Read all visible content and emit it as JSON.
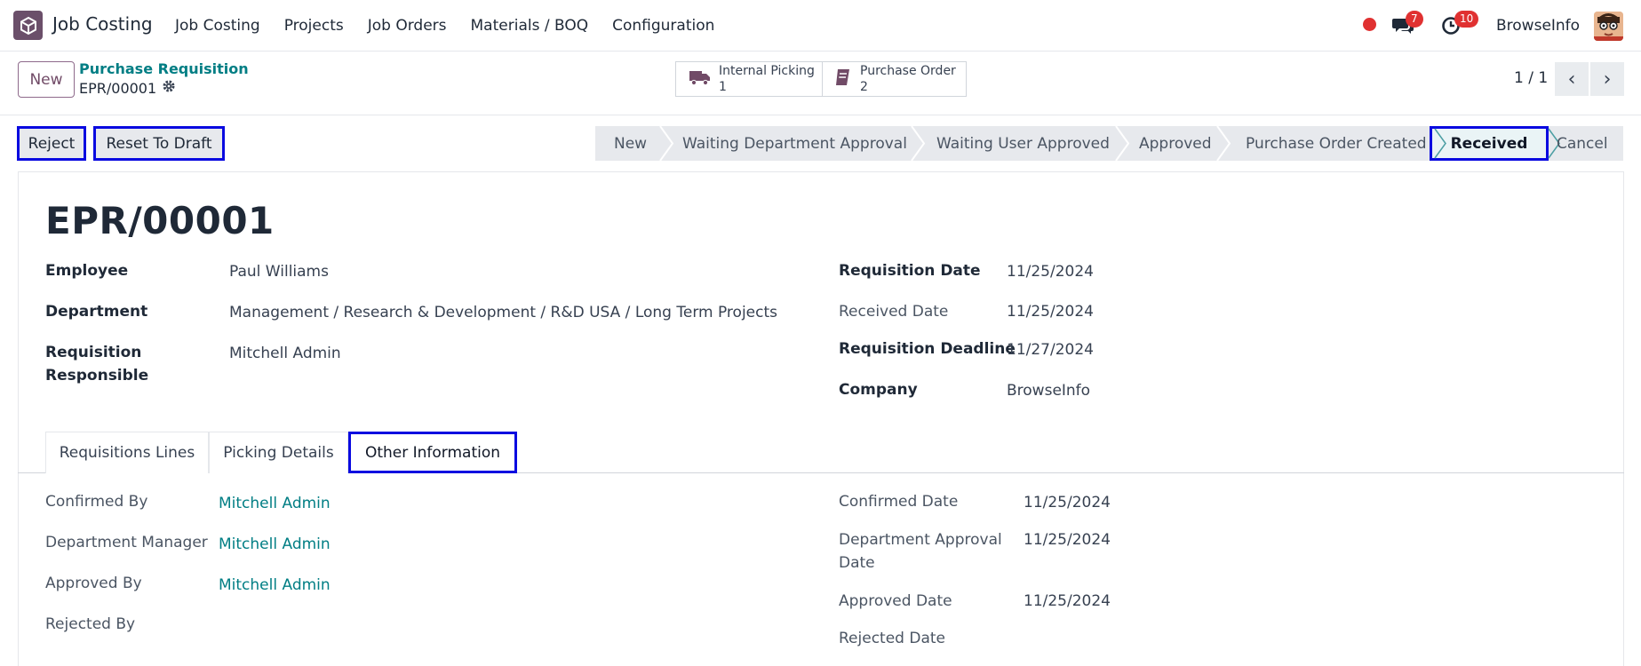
{
  "navbar": {
    "app_name": "Job Costing",
    "menu": [
      "Job Costing",
      "Projects",
      "Job Orders",
      "Materials / BOQ",
      "Configuration"
    ],
    "chat_count": "7",
    "activity_count": "10",
    "user_name": "BrowseInfo"
  },
  "control_panel": {
    "new_label": "New",
    "breadcrumb_parent": "Purchase Requisition",
    "breadcrumb_current": "EPR/00001",
    "smart_buttons": [
      {
        "label": "Internal Picking",
        "count": "1",
        "icon": "truck-icon"
      },
      {
        "label": "Purchase Order",
        "count": "2",
        "icon": "book-icon"
      }
    ],
    "pager": "1 / 1"
  },
  "actions": {
    "reject_label": "Reject",
    "reset_label": "Reset To Draft"
  },
  "status": {
    "stages": [
      "New",
      "Waiting Department Approval",
      "Waiting User Approved",
      "Approved",
      "Purchase Order Created",
      "Received",
      "Cancel"
    ],
    "active": "Received"
  },
  "form": {
    "title": "EPR/00001",
    "left": {
      "employee_label": "Employee",
      "employee_value": "Paul Williams",
      "department_label": "Department",
      "department_value": "Management / Research & Development / R&D USA / Long Term Projects",
      "responsible_label_1": "Requisition",
      "responsible_label_2": "Responsible",
      "responsible_value": "Mitchell Admin"
    },
    "right": {
      "req_date_label": "Requisition Date",
      "req_date_value": "11/25/2024",
      "received_date_label": "Received Date",
      "received_date_value": "11/25/2024",
      "deadline_label": "Requisition Deadline",
      "deadline_value": "11/27/2024",
      "company_label": "Company",
      "company_value": "BrowseInfo"
    }
  },
  "tabs": [
    "Requisitions Lines",
    "Picking Details",
    "Other Information"
  ],
  "active_tab": "Other Information",
  "other_info": {
    "left": [
      {
        "label": "Confirmed By",
        "value": "Mitchell Admin"
      },
      {
        "label": "Department Manager",
        "value": "Mitchell Admin"
      },
      {
        "label": "Approved By",
        "value": "Mitchell Admin"
      },
      {
        "label": "Rejected By",
        "value": ""
      }
    ],
    "right": [
      {
        "label": "Confirmed Date",
        "value": "11/25/2024"
      },
      {
        "label_1": "Department Approval",
        "label_2": "Date",
        "value": "11/25/2024"
      },
      {
        "label": "Approved Date",
        "value": "11/25/2024"
      },
      {
        "label": "Rejected Date",
        "value": ""
      }
    ]
  },
  "colors": {
    "brand": "#714b67",
    "link": "#017e84",
    "highlight_outline": "#0a0ae0",
    "badge": "#e03131"
  }
}
